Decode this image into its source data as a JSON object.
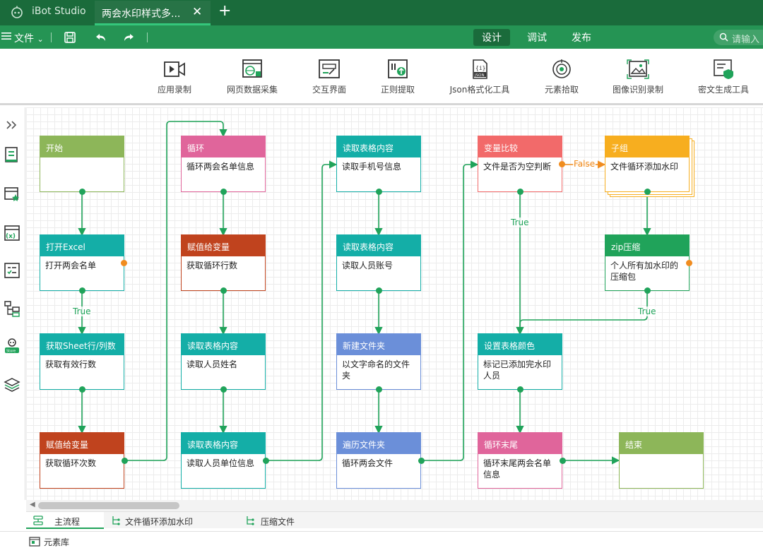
{
  "app": {
    "name": "iBot Studio",
    "doc_tab": "两会水印样式多...",
    "close_glyph": "✕",
    "new_tab_glyph": "+"
  },
  "menubar": {
    "file_label": "文件",
    "file_caret": "⌄",
    "modes": [
      "设计",
      "调试",
      "发布"
    ],
    "active_mode": "设计",
    "search_placeholder": "请输入"
  },
  "toolbar": {
    "tools": [
      {
        "label": "应用录制",
        "icon": "video-record-icon"
      },
      {
        "label": "网页数据采集",
        "icon": "web-scrape-icon"
      },
      {
        "label": "交互界面",
        "icon": "form-ui-icon"
      },
      {
        "label": "正则提取",
        "icon": "regex-extract-icon"
      },
      {
        "label": "Json格式化工具",
        "icon": "json-file-icon"
      },
      {
        "label": "元素拾取",
        "icon": "target-pick-icon"
      },
      {
        "label": "图像识别录制",
        "icon": "image-recognize-icon"
      },
      {
        "label": "密文生成工具",
        "icon": "cipher-generate-icon"
      }
    ]
  },
  "colors": {
    "start": "#8db659",
    "teal": "#14aea7",
    "red": "#c0431e",
    "pink": "#e0659b",
    "blue": "#6b8fd9",
    "coral": "#f26a6a",
    "yellow": "#f7ae1f",
    "green": "#20a35a",
    "wire": "#20a35a",
    "false_wire": "#f08c1f"
  },
  "nodes": {
    "start": {
      "title": "开始",
      "body": ""
    },
    "open_excel": {
      "title": "打开Excel",
      "body": "打开两会名单"
    },
    "get_rows": {
      "title": "获取Sheet行/列数",
      "body": "获取有效行数"
    },
    "assign1": {
      "title": "赋值给变量",
      "body": "获取循环次数"
    },
    "loop": {
      "title": "循环",
      "body": "循环两会名单信息"
    },
    "assign2": {
      "title": "赋值给变量",
      "body": "获取循环行数"
    },
    "read_name": {
      "title": "读取表格内容",
      "body": "读取人员姓名"
    },
    "read_unit": {
      "title": "读取表格内容",
      "body": "读取人员单位信息"
    },
    "read_phone": {
      "title": "读取表格内容",
      "body": "读取手机号信息"
    },
    "read_acct": {
      "title": "读取表格内容",
      "body": "读取人员账号"
    },
    "new_folder": {
      "title": "新建文件夹",
      "body": "以文字命名的文件夹"
    },
    "iter_files": {
      "title": "遍历文件夹",
      "body": "循环两会文件"
    },
    "compare": {
      "title": "变量比较",
      "body": "文件是否为空判断"
    },
    "set_color": {
      "title": "设置表格颜色",
      "body": "标记已添加完水印人员"
    },
    "loop_end": {
      "title": "循环末尾",
      "body": "循环末尾两会名单信息"
    },
    "subgroup": {
      "title": "子组",
      "body": "文件循环添加水印"
    },
    "zip": {
      "title": "zip压缩",
      "body": "个人所有加水印的压缩包"
    },
    "end": {
      "title": "结束",
      "body": ""
    }
  },
  "edge_labels": {
    "true1": "True",
    "true2": "True",
    "true3": "True",
    "false1": "False"
  },
  "flow_tabs": [
    "主流程",
    "文件循环添加水印",
    "压缩文件"
  ],
  "active_flow_tab": "主流程",
  "element_library": "元素库"
}
